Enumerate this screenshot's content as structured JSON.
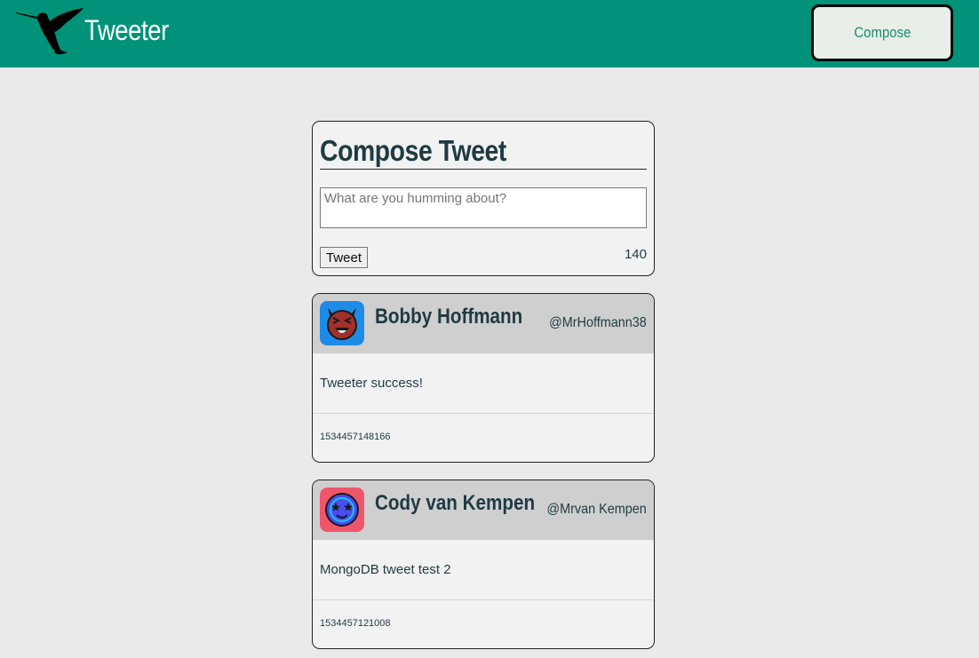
{
  "nav": {
    "brand": "Tweeter",
    "logo_icon": "hummingbird-icon",
    "compose_label": "Compose",
    "colors": {
      "bar": "#00937a",
      "button_bg": "#e7efe8",
      "button_text": "#1e8a72"
    }
  },
  "compose": {
    "title": "Compose Tweet",
    "placeholder": "What are you humming about?",
    "tweet_label": "Tweet",
    "counter": "140"
  },
  "tweets": [
    {
      "name": "Bobby Hoffmann",
      "handle": "@MrHoffmann38",
      "text": "Tweeter success!",
      "timestamp": "1534457148166",
      "avatar_icon": "devil-face-avatar-icon",
      "avatar_colors": {
        "bg": "#1e8ce6",
        "face": "#a1302a"
      }
    },
    {
      "name": "Cody van Kempen",
      "handle": "@Mrvan Kempen",
      "text": "MongoDB tweet test 2",
      "timestamp": "1534457121008",
      "avatar_icon": "starry-eyed-face-avatar-icon",
      "avatar_colors": {
        "bg": "#f0566b",
        "face": "#4a4ef0"
      }
    }
  ],
  "colors": {
    "page_bg": "#eaeaea",
    "card_bg": "#f2f2f2",
    "header_bg": "#cfcfcf",
    "text_dark": "#1f3a42"
  }
}
